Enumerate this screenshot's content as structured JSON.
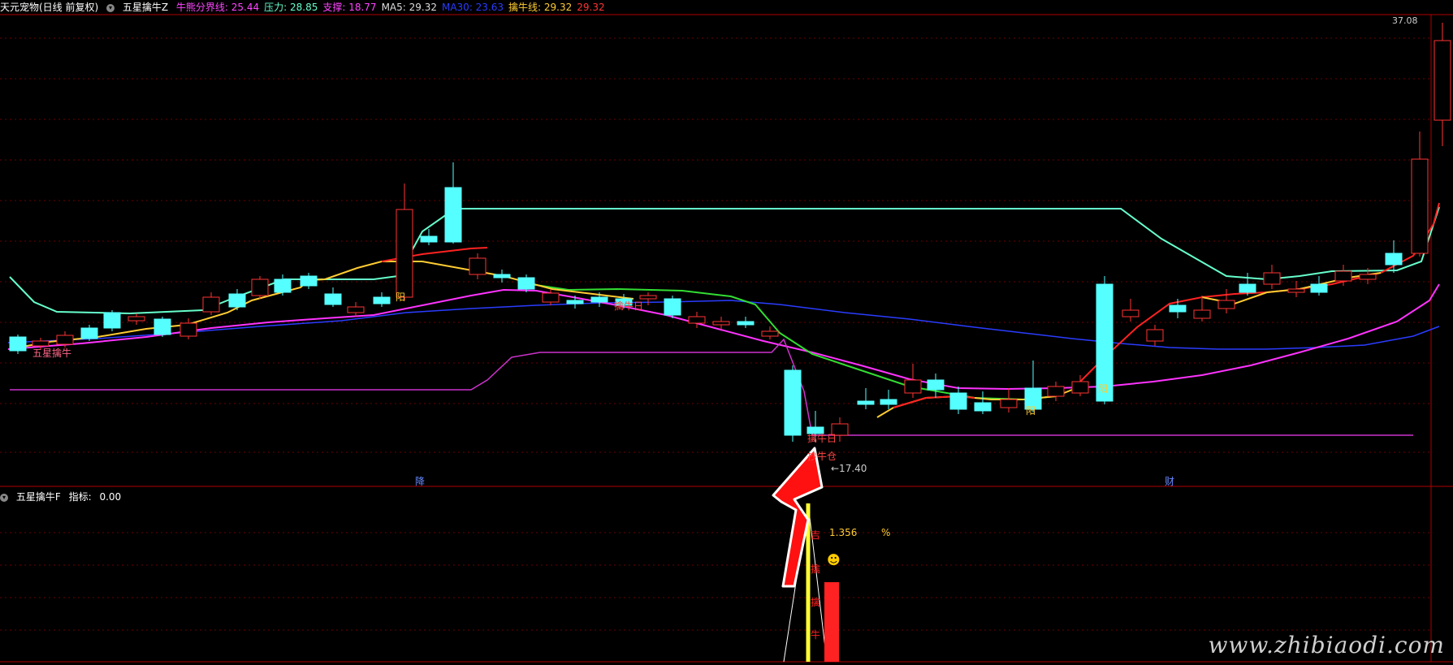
{
  "header": {
    "stock": "天元宠物(日线 前复权)",
    "indicator": "五星擒牛Z",
    "items": [
      {
        "label": "牛熊分界线:",
        "value": "25.44",
        "color": "#ff44ff"
      },
      {
        "label": "压力:",
        "value": "28.85",
        "color": "#66ffcc"
      },
      {
        "label": "支撑:",
        "value": "18.77",
        "color": "#ff44ff"
      },
      {
        "label": "MA5:",
        "value": "29.32",
        "color": "#dddddd"
      },
      {
        "label": "MA30:",
        "value": "23.63",
        "color": "#2a3cff"
      },
      {
        "label": "擒牛线:",
        "value": "29.32",
        "color": "#ffcc33"
      },
      {
        "label": "",
        "value": "29.32",
        "color": "#ff3333"
      }
    ]
  },
  "subpanel": {
    "indicator": "五星擒牛F",
    "label": "指标:",
    "value": "0.00",
    "pct_value": "1.356",
    "pct_sign": "%",
    "smile": "☻"
  },
  "annotations": {
    "five_star": "五星擒牛",
    "yang1": "阳",
    "yang2": "阳",
    "yang3": "阳",
    "qinniu1": "擒牛日",
    "qinniu2": "擒牛日",
    "bottom_cang": "抄牛仓",
    "low_price": "←17.40",
    "high_price": "37.08",
    "axis_mark1": "降",
    "axis_mark2": "财",
    "vert_text": [
      "吉",
      "擒",
      "擒",
      "牛"
    ]
  },
  "watermark": "www.zhibiaodi.com",
  "colors": {
    "up": "#ff3333",
    "down": "#55ffff",
    "grid": "#7a0000"
  }
}
